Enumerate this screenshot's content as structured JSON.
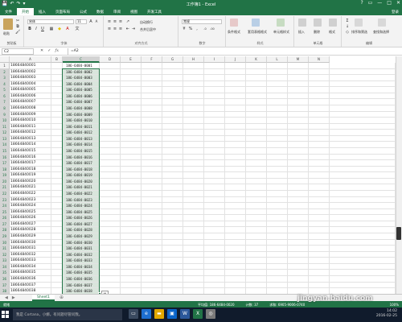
{
  "window": {
    "title": "工作簿1 - Excel",
    "qat": [
      "💾",
      "↶",
      "↷",
      "▾"
    ],
    "buttons": [
      "?",
      "▭",
      "—",
      "□",
      "✕"
    ]
  },
  "tabs": [
    {
      "label": "文件",
      "active": false
    },
    {
      "label": "开始",
      "active": true
    },
    {
      "label": "插入",
      "active": false
    },
    {
      "label": "页面布局",
      "active": false
    },
    {
      "label": "公式",
      "active": false
    },
    {
      "label": "数据",
      "active": false
    },
    {
      "label": "审阅",
      "active": false
    },
    {
      "label": "视图",
      "active": false
    },
    {
      "label": "开发工具",
      "active": false
    }
  ],
  "tabs_login": "登录",
  "ribbon": {
    "clipboard": {
      "label": "剪贴板",
      "paste": "粘贴"
    },
    "font": {
      "label": "字体",
      "name": "宋体",
      "size": "11"
    },
    "align": {
      "label": "对齐方式",
      "wrap": "自动换行",
      "merge": "合并后居中"
    },
    "number": {
      "label": "数字",
      "format": "常规"
    },
    "styles": {
      "label": "样式",
      "cond": "条件格式",
      "table": "套用表格格式",
      "cell": "单元格样式"
    },
    "cells": {
      "label": "单元格",
      "insert": "插入",
      "delete": "删除",
      "format": "格式"
    },
    "editing": {
      "label": "编辑",
      "sort": "排序和筛选",
      "find": "查找和选择"
    }
  },
  "formula_bar": {
    "name_box": "C2",
    "formula": "=A2"
  },
  "columns": [
    "A",
    "B",
    "C",
    "D",
    "E",
    "F",
    "G",
    "H",
    "I",
    "J",
    "K",
    "L",
    "M",
    "N"
  ],
  "rows": [
    {
      "n": "1",
      "a": "18664840001",
      "c": "186-6484-0001"
    },
    {
      "n": "2",
      "a": "18664840002",
      "c": "186-6484-0002"
    },
    {
      "n": "3",
      "a": "18664840003",
      "c": "186-6484-0003"
    },
    {
      "n": "4",
      "a": "18664840004",
      "c": "186-6484-0004"
    },
    {
      "n": "5",
      "a": "18664840005",
      "c": "186-6484-0005"
    },
    {
      "n": "6",
      "a": "18664840006",
      "c": "186-6484-0006"
    },
    {
      "n": "7",
      "a": "18664840007",
      "c": "186-6484-0007"
    },
    {
      "n": "8",
      "a": "18664840008",
      "c": "186-6484-0008"
    },
    {
      "n": "9",
      "a": "18664840009",
      "c": "186-6484-0009"
    },
    {
      "n": "10",
      "a": "18664840010",
      "c": "186-6484-0010"
    },
    {
      "n": "11",
      "a": "18664840011",
      "c": "186-6484-0011"
    },
    {
      "n": "12",
      "a": "18664840012",
      "c": "186-6484-0012"
    },
    {
      "n": "13",
      "a": "18664840013",
      "c": "186-6484-0013"
    },
    {
      "n": "14",
      "a": "18664840014",
      "c": "186-6484-0014"
    },
    {
      "n": "15",
      "a": "18664840015",
      "c": "186-6484-0015"
    },
    {
      "n": "16",
      "a": "18664840016",
      "c": "186-6484-0016"
    },
    {
      "n": "17",
      "a": "18664840017",
      "c": "186-6484-0017"
    },
    {
      "n": "18",
      "a": "18664840018",
      "c": "186-6484-0018"
    },
    {
      "n": "19",
      "a": "18664840019",
      "c": "186-6484-0019"
    },
    {
      "n": "20",
      "a": "18664840020",
      "c": "186-6484-0020"
    },
    {
      "n": "21",
      "a": "18664840021",
      "c": "186-6484-0021"
    },
    {
      "n": "22",
      "a": "18664840022",
      "c": "186-6484-0022"
    },
    {
      "n": "23",
      "a": "18664840023",
      "c": "186-6484-0023"
    },
    {
      "n": "24",
      "a": "18664840024",
      "c": "186-6484-0024"
    },
    {
      "n": "25",
      "a": "18664840025",
      "c": "186-6484-0025"
    },
    {
      "n": "26",
      "a": "18664840026",
      "c": "186-6484-0026"
    },
    {
      "n": "27",
      "a": "18664840027",
      "c": "186-6484-0027"
    },
    {
      "n": "28",
      "a": "18664840028",
      "c": "186-6484-0028"
    },
    {
      "n": "29",
      "a": "18664840029",
      "c": "186-6484-0029"
    },
    {
      "n": "30",
      "a": "18664840030",
      "c": "186-6484-0030"
    },
    {
      "n": "31",
      "a": "18664840031",
      "c": "186-6484-0031"
    },
    {
      "n": "32",
      "a": "18664840032",
      "c": "186-6484-0032"
    },
    {
      "n": "33",
      "a": "18664840033",
      "c": "186-6484-0033"
    },
    {
      "n": "34",
      "a": "18664840034",
      "c": "186-6484-0034"
    },
    {
      "n": "35",
      "a": "18664840035",
      "c": "186-6484-0035"
    },
    {
      "n": "36",
      "a": "18664840036",
      "c": "186-6484-0036"
    },
    {
      "n": "37",
      "a": "18664840037",
      "c": "186-6484-0037"
    },
    {
      "n": "38",
      "a": "18664840038",
      "c": "186-6484-0038"
    }
  ],
  "sheets": [
    {
      "label": "Sheet1",
      "active": true
    }
  ],
  "status": {
    "ready": "就绪",
    "average": "平均值: 186-6484-0020",
    "count": "计数: 37",
    "sum": "求和: 6905-9006-0740",
    "zoom": "100%"
  },
  "taskbar": {
    "search_placeholder": "我是 Cortana，小娜。有问题尽管问我。",
    "time": "14:02",
    "date": "2016-02-25"
  },
  "watermark": "jingyan.baidu.com",
  "colors": {
    "excel_green": "#217346",
    "selection_fill": "#d9e5dc",
    "taskbar": "#101b2c"
  }
}
